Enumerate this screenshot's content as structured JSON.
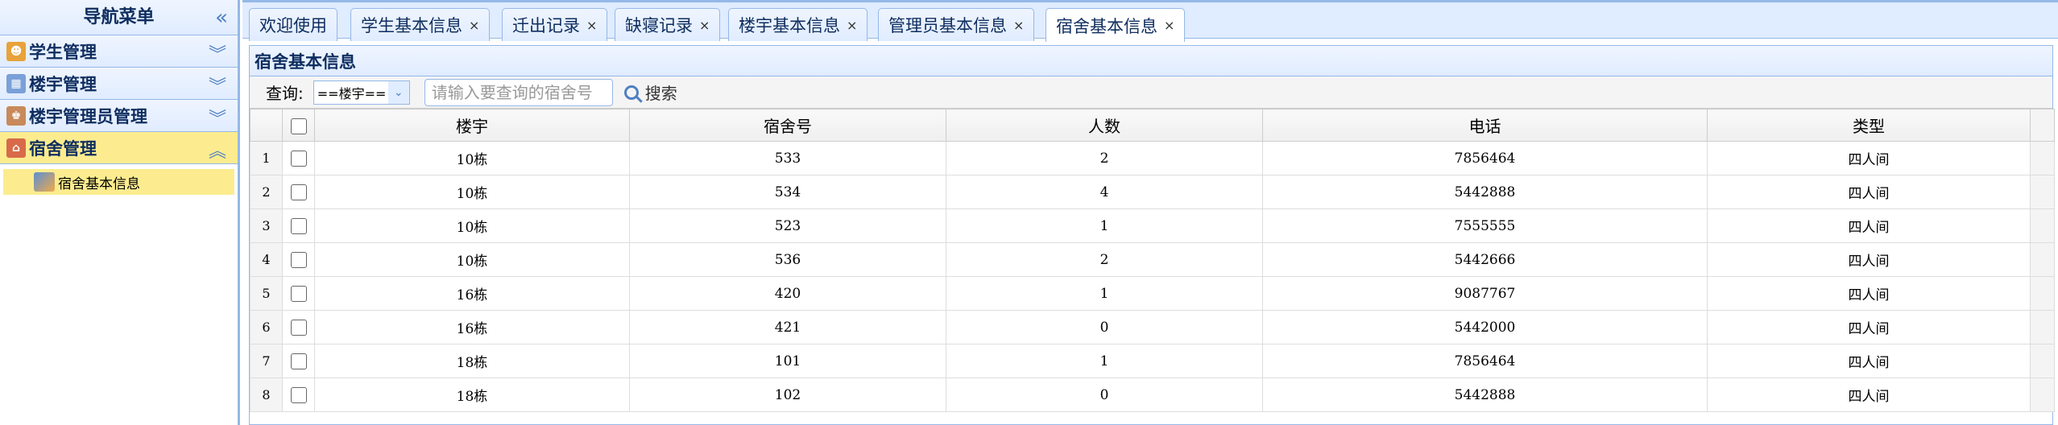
{
  "nav": {
    "title": "导航菜单",
    "collapse_icon": "double-chevron-left-icon",
    "groups": [
      {
        "label": "学生管理",
        "icon": "student-icon",
        "color": "#e8a23a",
        "expanded": false
      },
      {
        "label": "楼宇管理",
        "icon": "building-icon",
        "color": "#7aa0d8",
        "expanded": false
      },
      {
        "label": "楼宇管理员管理",
        "icon": "admin-icon",
        "color": "#c88a5a",
        "expanded": false
      },
      {
        "label": "宿舍管理",
        "icon": "dorm-icon",
        "color": "#d86a4a",
        "expanded": true
      }
    ],
    "sub_items": [
      {
        "label": "宿舍基本信息",
        "icon": "dorm-info-icon",
        "selected": true
      }
    ]
  },
  "tabs": [
    {
      "label": "欢迎使用",
      "closable": false,
      "active": false
    },
    {
      "label": "学生基本信息",
      "closable": true,
      "active": false
    },
    {
      "label": "迁出记录",
      "closable": true,
      "active": false
    },
    {
      "label": "缺寝记录",
      "closable": true,
      "active": false
    },
    {
      "label": "楼宇基本信息",
      "closable": true,
      "active": false
    },
    {
      "label": "管理员基本信息",
      "closable": true,
      "active": false
    },
    {
      "label": "宿舍基本信息",
      "closable": true,
      "active": true
    }
  ],
  "tab_close_symbol": "×",
  "panel": {
    "title": "宿舍基本信息",
    "toolbar": {
      "query_label": "查询:",
      "select_value": "==楼宇==",
      "search_placeholder": "请输入要查询的宿舍号",
      "search_button": "搜索"
    }
  },
  "grid": {
    "columns": [
      "楼宇",
      "宿舍号",
      "人数",
      "电话",
      "类型"
    ],
    "rows": [
      {
        "n": "1",
        "building": "10栋",
        "room": "533",
        "count": "2",
        "phone": "7856464",
        "type": "四人间"
      },
      {
        "n": "2",
        "building": "10栋",
        "room": "534",
        "count": "4",
        "phone": "5442888",
        "type": "四人间"
      },
      {
        "n": "3",
        "building": "10栋",
        "room": "523",
        "count": "1",
        "phone": "7555555",
        "type": "四人间"
      },
      {
        "n": "4",
        "building": "10栋",
        "room": "536",
        "count": "2",
        "phone": "5442666",
        "type": "四人间"
      },
      {
        "n": "5",
        "building": "16栋",
        "room": "420",
        "count": "1",
        "phone": "9087767",
        "type": "四人间"
      },
      {
        "n": "6",
        "building": "16栋",
        "room": "421",
        "count": "0",
        "phone": "5442000",
        "type": "四人间"
      },
      {
        "n": "7",
        "building": "18栋",
        "room": "101",
        "count": "1",
        "phone": "7856464",
        "type": "四人间"
      },
      {
        "n": "8",
        "building": "18栋",
        "room": "102",
        "count": "0",
        "phone": "5442888",
        "type": "四人间"
      }
    ]
  },
  "colors": {
    "accent_border": "#95b8e7",
    "header_bg": "#e0ecff",
    "selected_bg": "#fcec8f"
  }
}
